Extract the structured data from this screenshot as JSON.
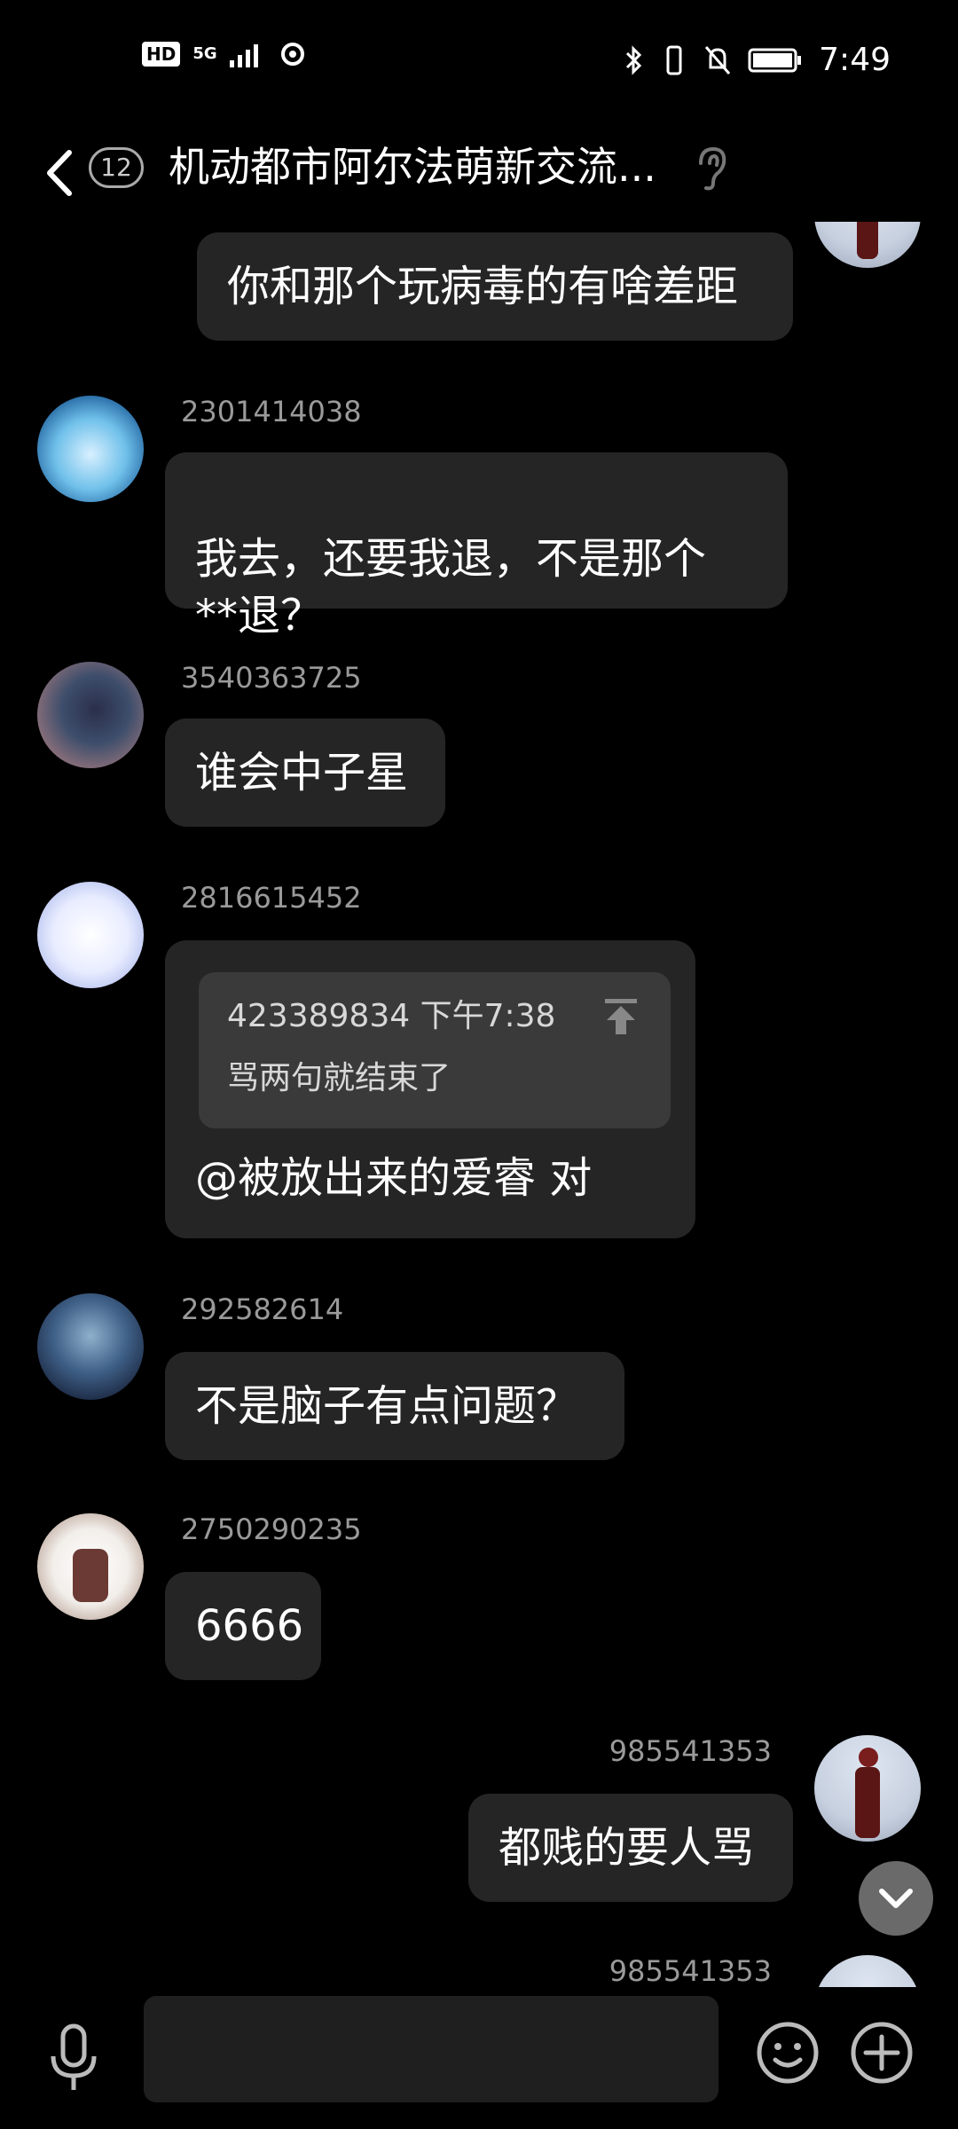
{
  "status_bar": {
    "hd": "HD",
    "network": "5G",
    "time": "7:49"
  },
  "header": {
    "unread_count": "12",
    "title": "机动都市阿尔法萌新交流..."
  },
  "messages": [
    {
      "text": "你和那个玩病毒的有啥差距"
    },
    {
      "sender": "2301414038",
      "text": "我去，还要我退，不是那个\n**退？"
    },
    {
      "sender": "3540363725",
      "text": "谁会中子星"
    },
    {
      "sender": "2816615452",
      "quote_header": "423389834 下午7:38",
      "quote_text": "骂两句就结束了",
      "text": "@被放出来的爱睿 对"
    },
    {
      "sender": "292582614",
      "text": "不是脑子有点问题？"
    },
    {
      "sender": "2750290235",
      "text": "6666"
    },
    {
      "sender": "985541353",
      "text": "都贱的要人骂"
    },
    {
      "sender": "985541353"
    }
  ],
  "input": {
    "placeholder": ""
  },
  "icons": {
    "back": "chevron-left-icon",
    "ear": "ear-icon",
    "scroll_down": "chevron-down-icon",
    "voice": "microphone-icon",
    "emoji": "smiley-icon",
    "plus": "plus-icon"
  },
  "colors": {
    "background": "#000000",
    "bubble": "#252525",
    "quote": "#3a3a3a",
    "meta_text": "#9a9a9a"
  }
}
